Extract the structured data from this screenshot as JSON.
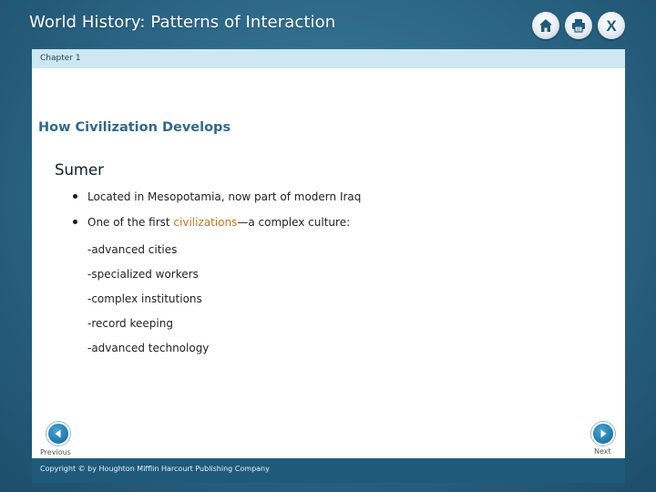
{
  "app": {
    "title": "World History: Patterns of Interaction"
  },
  "toolbar": {
    "home_icon": "home-icon",
    "print_icon": "printer-icon",
    "close_label": "X"
  },
  "slide": {
    "chapter": "Chapter 1",
    "section_title": "How Civilization Develops",
    "topic_title": "Sumer",
    "bullets": [
      {
        "text": "Located in Mesopotamia, now part of modern Iraq"
      },
      {
        "pre": "One of the first ",
        "term": "civilizations",
        "post": "—a complex culture:"
      }
    ],
    "sub_items": [
      "-advanced cities",
      "-specialized workers",
      "-complex institutions",
      "-record keeping",
      "-advanced technology"
    ],
    "term_color": "#c3761a"
  },
  "navigation": {
    "previous_label": "Previous",
    "next_label": "Next"
  },
  "footer": {
    "copyright": "Copyright © by Houghton Mifflin Harcourt Publishing Company"
  }
}
